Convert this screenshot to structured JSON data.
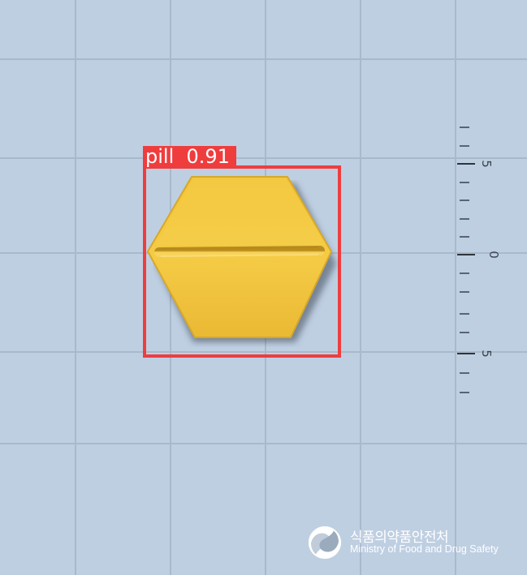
{
  "scene": {
    "background_color": "#bfcfe2",
    "gridline_color": "#a9b9cc"
  },
  "ruler": {
    "labels": [
      "5",
      "0",
      "5"
    ]
  },
  "pill": {
    "shape": "hexagon",
    "color": "#f4c83c",
    "score_line": true
  },
  "detection": {
    "label": "pill",
    "confidence": "0.91",
    "text": "pill  0.91",
    "box_color": "#ef3d3e"
  },
  "watermark": {
    "org_korean": "식품의약품안전처",
    "org_english": "Ministry of Food and Drug Safety",
    "emblem_icon": "mfds-emblem-icon"
  }
}
